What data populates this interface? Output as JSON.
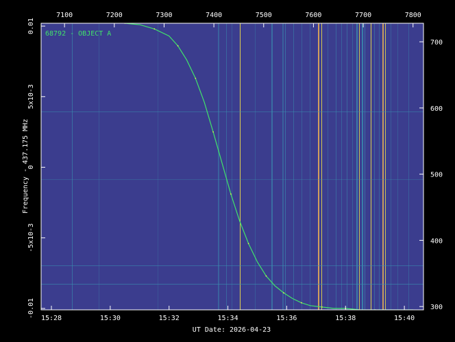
{
  "chart_data": {
    "type": "line",
    "annotation": "68792 - OBJECT A",
    "xlabel": "UT Date: 2026-04-23",
    "ylabel": "Frequency - 437.175 MHz",
    "x_ticks_bottom": [
      "15:28",
      "15:30",
      "15:32",
      "15:34",
      "15:36",
      "15:38",
      "15:40"
    ],
    "x_ticks_bottom_minutes": [
      928,
      930,
      932,
      934,
      936,
      938,
      940
    ],
    "x_ticks_top": [
      "7100",
      "7200",
      "7300",
      "7400",
      "7500",
      "7600",
      "7700",
      "7800"
    ],
    "x_ticks_top_values": [
      7100,
      7200,
      7300,
      7400,
      7500,
      7600,
      7700,
      7800
    ],
    "y_ticks_left": [
      "-0.01",
      "-5x10-3",
      "0",
      "5x10-3",
      "0.01"
    ],
    "y_ticks_left_values": [
      -0.01,
      -0.005,
      0,
      0.005,
      0.01
    ],
    "y_ticks_right": [
      "300",
      "400",
      "500",
      "600",
      "700"
    ],
    "y_ticks_right_values": [
      300,
      400,
      500,
      600,
      700
    ],
    "xlim_minutes": [
      927.65,
      940.65
    ],
    "xlim_top": [
      7053,
      7821
    ],
    "ylim": [
      -0.0101,
      0.0102
    ],
    "ylim_right": [
      295,
      728
    ],
    "series": [
      {
        "minutes": [
          927.65,
          928,
          928.5,
          929,
          929.5,
          930,
          930.5,
          931,
          931.5,
          932,
          932.3,
          932.6,
          932.9,
          933.2,
          933.5,
          933.8,
          934.1,
          934.4,
          934.7,
          935,
          935.3,
          935.6,
          935.9,
          936.2,
          936.5,
          936.8,
          937.2,
          937.6,
          938,
          938.5,
          939,
          939.5,
          940,
          940.3
        ],
        "values": [
          0.0104,
          0.0104,
          0.0104,
          0.0104,
          0.0104,
          0.0103,
          0.0102,
          0.0101,
          0.0098,
          0.0093,
          0.0086,
          0.0076,
          0.0063,
          0.0046,
          0.0025,
          0.0003,
          -0.0019,
          -0.0038,
          -0.0054,
          -0.0067,
          -0.0077,
          -0.0084,
          -0.0089,
          -0.0093,
          -0.0096,
          -0.0098,
          -0.0099,
          -0.01,
          -0.01,
          -0.0101,
          -0.0101,
          -0.0101,
          -0.0101,
          -0.0101
        ]
      }
    ],
    "colors": {
      "background": "#000000",
      "plot_fill": "#3b3d8e",
      "curve": "#41e36b",
      "curve_bright": "#e8f24a",
      "rfi_cyan": "#3a8fb0",
      "rfi_orange": "#d9a35a",
      "rfi_yellow": "#e9d84a",
      "axis": "#ffffff"
    }
  }
}
